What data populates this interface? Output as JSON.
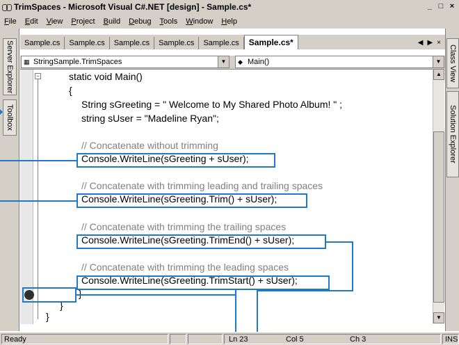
{
  "window": {
    "title": "TrimSpaces - Microsoft Visual C#.NET [design] - Sample.cs*",
    "buttons": {
      "minimize": "_",
      "maximize": "□",
      "close": "×"
    }
  },
  "menu": {
    "items": [
      {
        "hot": "F",
        "rest": "ile"
      },
      {
        "hot": "E",
        "rest": "dit"
      },
      {
        "hot": "V",
        "rest": "iew"
      },
      {
        "hot": "P",
        "rest": "roject"
      },
      {
        "hot": "B",
        "rest": "uild"
      },
      {
        "hot": "D",
        "rest": "ebug"
      },
      {
        "hot": "T",
        "rest": "ools"
      },
      {
        "hot": "W",
        "rest": "indow"
      },
      {
        "hot": "H",
        "rest": "elp"
      }
    ]
  },
  "left_tabs": {
    "server_explorer": "Server Explorer",
    "toolbox": "Toolbox"
  },
  "right_tabs": {
    "class_view": "Class View",
    "solution_explorer": "Solution Explorer"
  },
  "doc_tabs": {
    "tabs": [
      "Sample.cs",
      "Sample.cs",
      "Sample.cs",
      "Sample.cs",
      "Sample.cs"
    ],
    "active": "Sample.cs*",
    "controls": {
      "prev": "◀",
      "next": "▶",
      "close": "×"
    }
  },
  "dropdowns": {
    "class": {
      "value": "StringSample.TrimSpaces",
      "icon": "class-icon"
    },
    "member": {
      "value": "Main()",
      "icon": "method-icon"
    }
  },
  "code": {
    "line1": "static void Main()",
    "line2": "{",
    "line3": "String sGreeting = \" Welcome to My Shared Photo Album! \" ;",
    "line4": "string sUser = \"Madeline Ryan\";",
    "c1": "// Concatenate without trimming",
    "s1": "Console.WriteLine(sGreeting + sUser);",
    "c2": "// Concatenate with trimming leading and trailing spaces",
    "s2": "Console.WriteLine(sGreeting.Trim() + sUser);",
    "c3": "// Concatenate with trimming the trailing spaces",
    "s3": "Console.WriteLine(sGreeting.TrimEnd() + sUser);",
    "c4": "// Concatenate with trimming the leading spaces",
    "s4": "Console.WriteLine(sGreeting.TrimStart() + sUser);",
    "close_method": "}",
    "close_class": "}",
    "close_ns": "}"
  },
  "status": {
    "ready": "Ready",
    "line": "Ln 23",
    "col": "Col 5",
    "ch": "Ch 3",
    "ins": "INS"
  },
  "colors": {
    "callout": "#1f78c8",
    "chrome": "#d4d0c8"
  }
}
